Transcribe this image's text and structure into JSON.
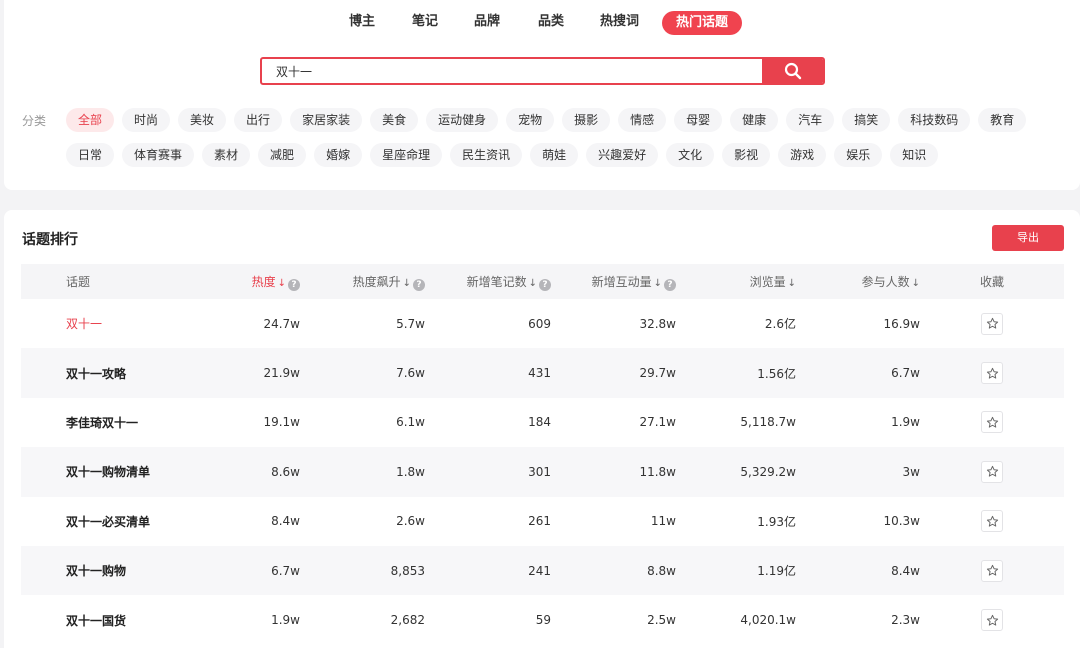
{
  "nav": {
    "items": [
      "博主",
      "笔记",
      "品牌",
      "品类",
      "热搜词",
      "热门话题"
    ],
    "active_index": 5
  },
  "search": {
    "value": "双十一",
    "icon": "search-icon"
  },
  "categories": {
    "label": "分类",
    "row1": [
      "全部",
      "时尚",
      "美妆",
      "出行",
      "家居家装",
      "美食",
      "运动健身",
      "宠物",
      "摄影",
      "情感",
      "母婴",
      "健康",
      "汽车",
      "搞笑",
      "科技数码",
      "教育"
    ],
    "row2": [
      "日常",
      "体育赛事",
      "素材",
      "减肥",
      "婚嫁",
      "星座命理",
      "民生资讯",
      "萌娃",
      "兴趣爱好",
      "文化",
      "影视",
      "游戏",
      "娱乐",
      "知识"
    ],
    "active": "全部"
  },
  "ranking": {
    "title": "话题排行",
    "export_label": "导出",
    "columns": [
      "话题",
      "热度",
      "热度飙升",
      "新增笔记数",
      "新增互动量",
      "浏览量",
      "参与人数",
      "收藏"
    ],
    "sort_arrow": "↓",
    "help_mark": "?",
    "rows": [
      {
        "topic": "双十一",
        "heat": "24.7w",
        "surge": "5.7w",
        "notes": "609",
        "interact": "32.8w",
        "views": "2.6亿",
        "people": "16.9w"
      },
      {
        "topic": "双十一攻略",
        "heat": "21.9w",
        "surge": "7.6w",
        "notes": "431",
        "interact": "29.7w",
        "views": "1.56亿",
        "people": "6.7w"
      },
      {
        "topic": "李佳琦双十一",
        "heat": "19.1w",
        "surge": "6.1w",
        "notes": "184",
        "interact": "27.1w",
        "views": "5,118.7w",
        "people": "1.9w"
      },
      {
        "topic": "双十一购物清单",
        "heat": "8.6w",
        "surge": "1.8w",
        "notes": "301",
        "interact": "11.8w",
        "views": "5,329.2w",
        "people": "3w"
      },
      {
        "topic": "双十一必买清单",
        "heat": "8.4w",
        "surge": "2.6w",
        "notes": "261",
        "interact": "11w",
        "views": "1.93亿",
        "people": "10.3w"
      },
      {
        "topic": "双十一购物",
        "heat": "6.7w",
        "surge": "8,853",
        "notes": "241",
        "interact": "8.8w",
        "views": "1.19亿",
        "people": "8.4w"
      },
      {
        "topic": "双十一国货",
        "heat": "1.9w",
        "surge": "2,682",
        "notes": "59",
        "interact": "2.5w",
        "views": "4,020.1w",
        "people": "2.3w"
      }
    ]
  },
  "colors": {
    "accent": "#e8414d",
    "active_chip_bg": "#fde9ea"
  }
}
